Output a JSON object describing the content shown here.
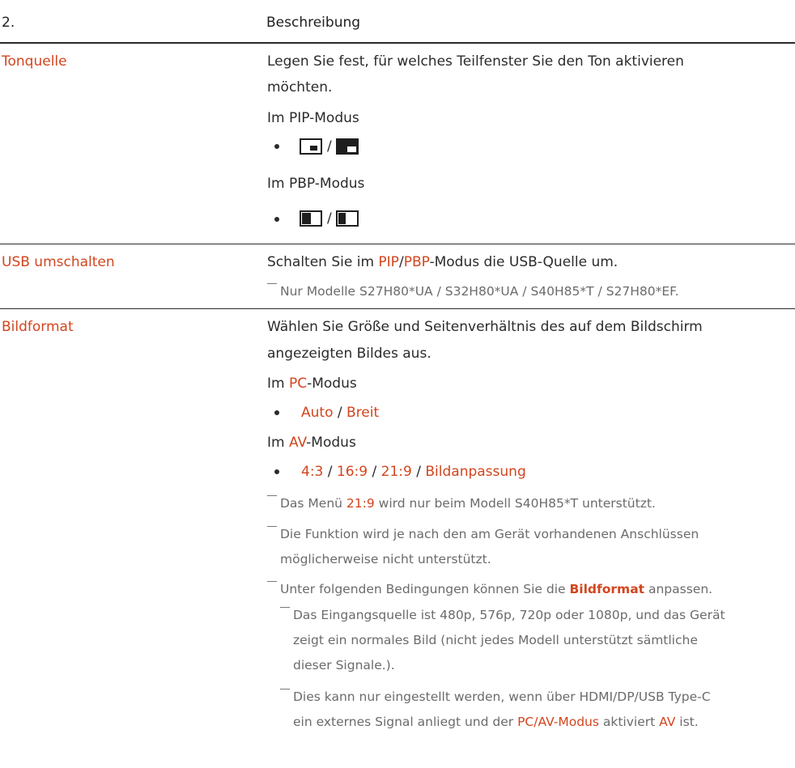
{
  "header": {
    "col1": "2.",
    "col2": "Beschreibung"
  },
  "tonquelle": {
    "label": "Tonquelle",
    "desc_line1": "Legen Sie fest, für welches Teilfenster Sie den Ton aktivieren",
    "desc_line2": "möchten.",
    "pip_mode": "Im PIP-Modus",
    "pbp_mode": "Im PBP-Modus",
    "separator": "/"
  },
  "usb": {
    "label": "USB umschalten",
    "desc_pre": "Schalten Sie im ",
    "pip": "PIP",
    "slash": "/",
    "pbp": "PBP",
    "desc_post": "-Modus die USB-Quelle um.",
    "note": "Nur Modelle S27H80*UA / S32H80*UA / S40H85*T / S27H80*EF."
  },
  "bildformat": {
    "label": "Bildformat",
    "desc_line1": "Wählen Sie Größe und Seitenverhältnis des auf dem Bildschirm",
    "desc_line2": "angezeigten Bildes aus.",
    "im": "Im ",
    "pc": "PC",
    "modus": "-Modus",
    "pc_opt1": "Auto",
    "pc_opt2": "Breit",
    "av": "AV",
    "av_opt1": "4:3",
    "av_opt2": "16:9",
    "av_opt3": "21:9",
    "av_opt4": "Bildanpassung",
    "sep": " / ",
    "note1_pre": "Das Menü ",
    "note1_hl": "21:9",
    "note1_post": " wird nur beim Modell S40H85*T unterstützt.",
    "note2_line1": "Die Funktion wird je nach den am Gerät vorhandenen Anschlüssen",
    "note2_line2": "möglicherweise nicht unterstützt.",
    "note3_pre": "Unter folgenden Bedingungen können Sie die ",
    "note3_hl": "Bildformat",
    "note3_post": " anpassen.",
    "sub1_line1": "Das Eingangsquelle ist 480p, 576p, 720p oder 1080p, und das Gerät",
    "sub1_line2": "zeigt ein normales Bild (nicht jedes Modell unterstützt sämtliche",
    "sub1_line3": "dieser Signale.).",
    "sub2_line1": "Dies kann nur eingestellt werden, wenn über HDMI/DP/USB Type-C",
    "sub2_line2_pre": "ein externes Signal anliegt und der ",
    "sub2_line2_hl1": "PC/AV-Modus",
    "sub2_line2_mid": " aktiviert ",
    "sub2_line2_hl2": "AV",
    "sub2_line2_post": " ist."
  }
}
